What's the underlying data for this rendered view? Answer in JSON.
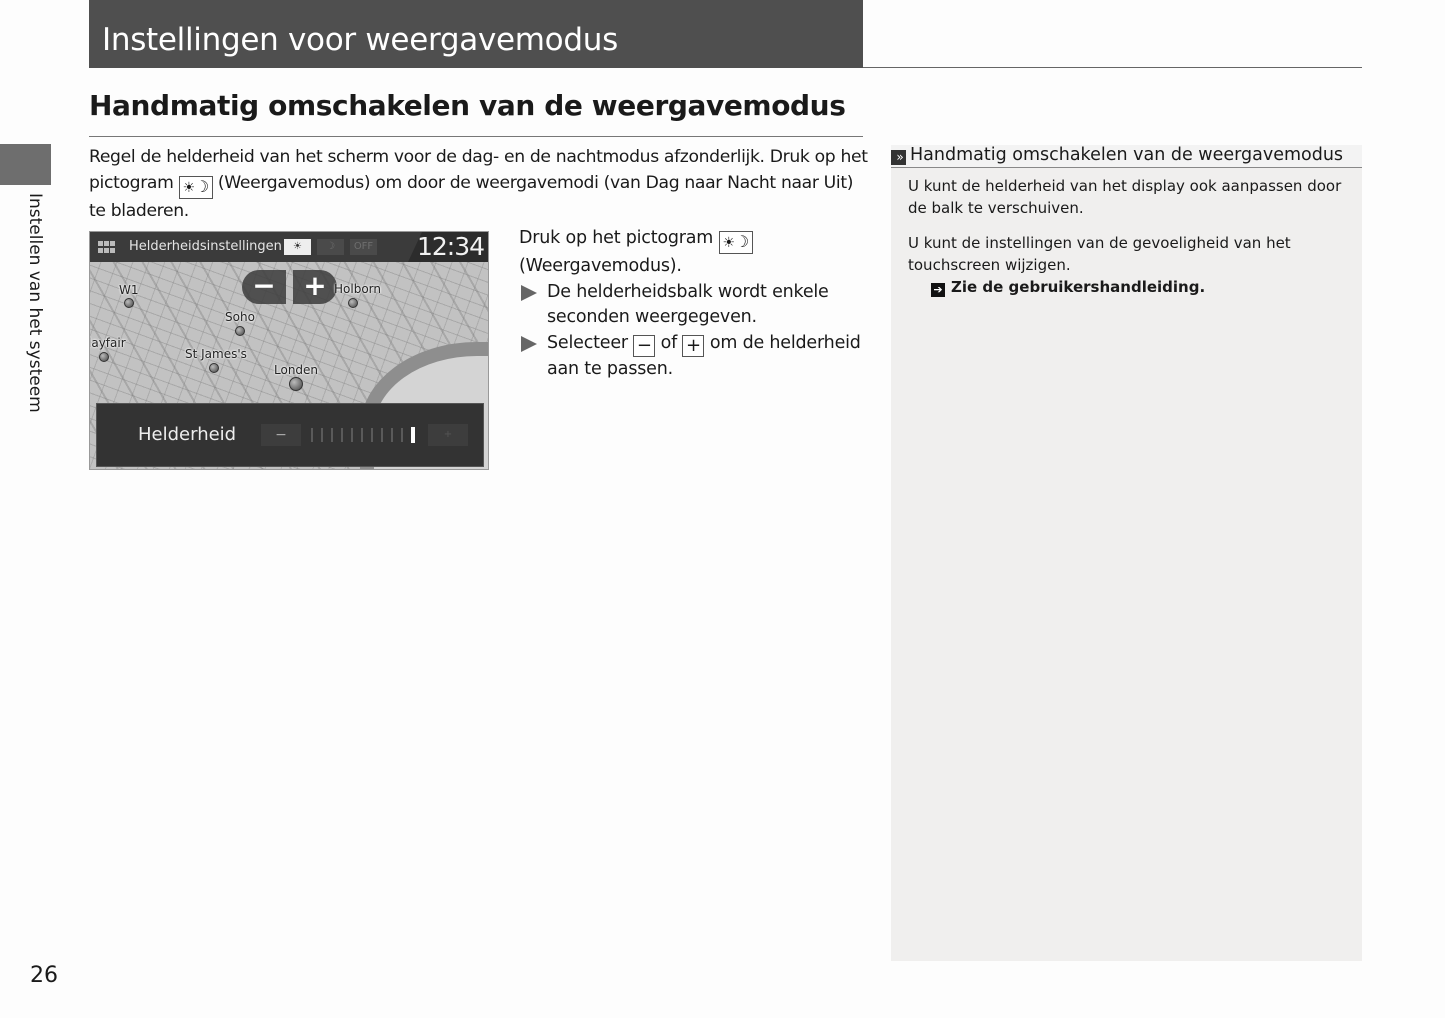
{
  "header": {
    "chapter_title": "Instellingen voor weergavemodus",
    "side_tab_label": "Instellen van het systeem"
  },
  "section": {
    "heading": "Handmatig omschakelen van de weergavemodus",
    "intro_part1": "Regel de helderheid van het scherm voor de dag- en de nachtmodus afzonderlijk. Druk op het pictogram ",
    "intro_part2": " (Weergavemodus) om door de weergavemodi (van Dag naar Nacht naar Uit) te bladeren.",
    "icon_display_mode": {
      "sun": "☀",
      "moon": "☽",
      "name": "display-mode-icon"
    }
  },
  "screenshot": {
    "screen_title": "Helderheidsinstellingen",
    "mode_buttons": [
      {
        "label": "☀",
        "name": "day",
        "active": true
      },
      {
        "label": "☽",
        "name": "night",
        "active": false
      },
      {
        "label": "OFF",
        "name": "off",
        "active": false
      }
    ],
    "clock": "12:34",
    "zoom_minus": "−",
    "zoom_plus": "+",
    "places": [
      "W1",
      "Holborn",
      "Soho",
      "layfair",
      "St James's",
      "Londen"
    ],
    "brightness_label": "Helderheid",
    "brightness_minus": "−",
    "brightness_plus": "+",
    "brightness_level": 11,
    "brightness_max": 11
  },
  "steps": {
    "step1_part1": "Druk op het pictogram ",
    "step1_part2": "(Weergavemodus).",
    "bullet1": "De helderheidsbalk wordt enkele seconden weergegeven.",
    "bullet2_part1": "Selecteer ",
    "bullet2_minus": "−",
    "bullet2_of": " of ",
    "bullet2_plus": "+",
    "bullet2_part2": " om de helderheid aan te passen."
  },
  "note": {
    "heading_icon": "»",
    "heading": "Handmatig omschakelen van de weergavemodus",
    "para1": "U kunt de helderheid van het display ook aanpassen door de balk te verschuiven.",
    "para2": "U kunt de instellingen van de gevoeligheid van het touchscreen wijzigen.",
    "ref_icon": "➔",
    "ref_text": "Zie de gebruikershandleiding."
  },
  "page_number": "26"
}
